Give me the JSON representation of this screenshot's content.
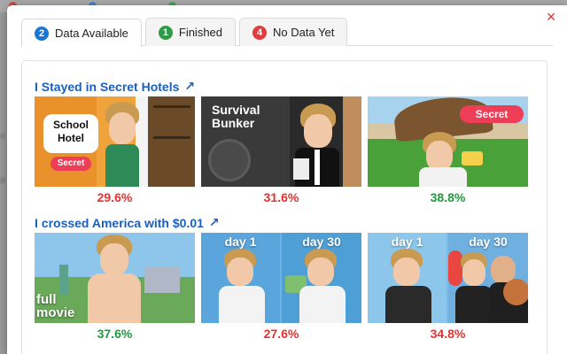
{
  "tabs": [
    {
      "badge": "2",
      "label": "Data Available",
      "color": "#1976d2",
      "active": true
    },
    {
      "badge": "1",
      "label": "Finished",
      "color": "#2e9b46",
      "active": false
    },
    {
      "badge": "4",
      "label": "No Data Yet",
      "color": "#e23d3d",
      "active": false
    }
  ],
  "close_symbol": "×",
  "sections": [
    {
      "title": "I Stayed in Secret Hotels",
      "link_icon": "↗",
      "videos": [
        {
          "overlay": "School Hotel",
          "pill": "Secret",
          "percent": "29.6%",
          "status_color": "#e23131"
        },
        {
          "overlay": "Survival Bunker",
          "percent": "31.6%",
          "status_color": "#e23131"
        },
        {
          "pill": "Secret",
          "percent": "38.8%",
          "status_color": "#1f9a3c"
        }
      ]
    },
    {
      "title": "I crossed America with $0.01",
      "link_icon": "↗",
      "videos": [
        {
          "overlay": "full movie",
          "percent": "37.6%",
          "status_color": "#1f9a3c"
        },
        {
          "left_label": "day 1",
          "right_label": "day 30",
          "percent": "27.6%",
          "status_color": "#e23131"
        },
        {
          "left_label": "day 1",
          "right_label": "day 30",
          "percent": "34.8%",
          "status_color": "#e23131"
        }
      ]
    }
  ]
}
